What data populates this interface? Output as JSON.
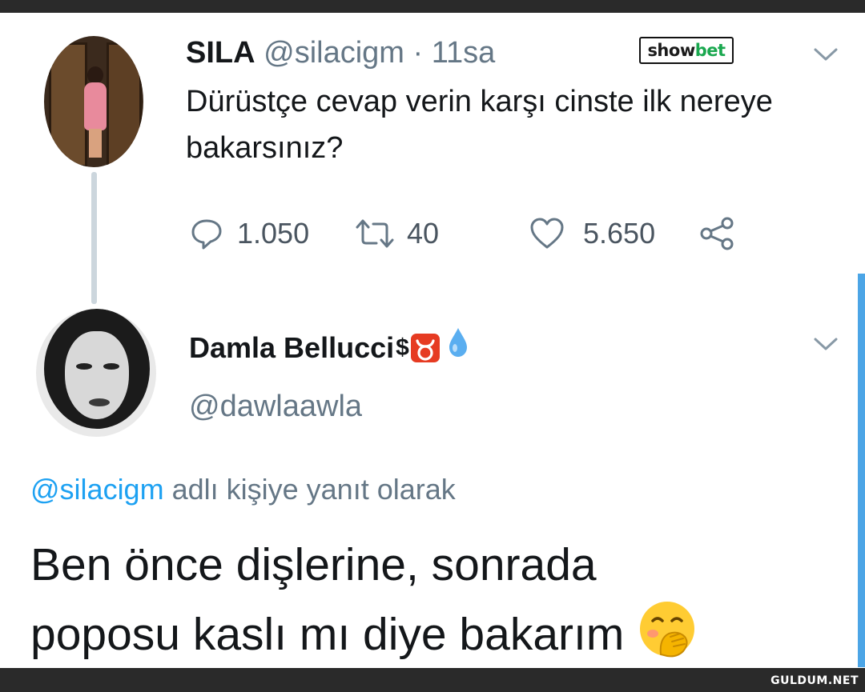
{
  "tweet": {
    "author_name": "SILA",
    "author_handle": "@silacigm",
    "separator": "·",
    "time": "11sa",
    "text": "Dürüstçe cevap verin karşı cinste ilk nereye bakarsınız?",
    "replies": "1.050",
    "retweets": "40",
    "likes": "5.650"
  },
  "logo": {
    "part1": "show",
    "part2": "bet"
  },
  "reply": {
    "author_name": "Damla Bellucci",
    "name_symbol": "$",
    "author_handle": "@dawlaawla",
    "reply_to_mention": "@silacigm",
    "reply_to_text": " adlı kişiye yanıt olarak",
    "text_line1": "Ben önce dişlerine, sonrada",
    "text_line2": "poposu kaslı mı diye bakarım"
  },
  "watermark": "GULDUM.NET",
  "colors": {
    "handle_gray": "#657786",
    "mention_blue": "#1da1f2",
    "accent_green": "#1aa84f"
  },
  "icons": [
    "reply-icon",
    "retweet-icon",
    "heart-icon",
    "share-icon",
    "chevron-down-icon",
    "taurus-icon",
    "droplet-icon",
    "hand-over-mouth-emoji"
  ]
}
